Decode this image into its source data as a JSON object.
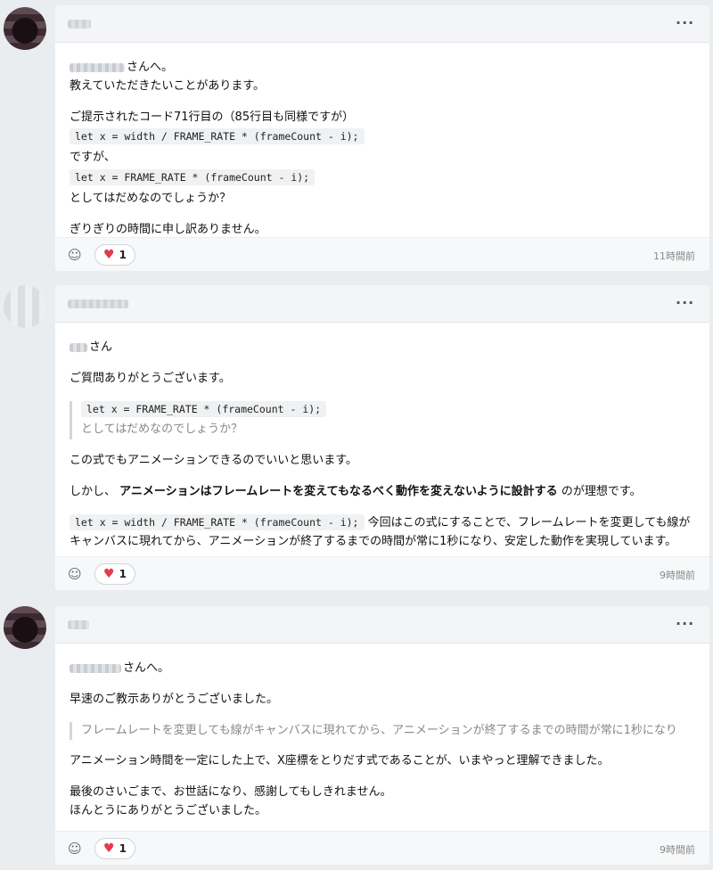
{
  "comments": [
    {
      "username_masked": "",
      "mention_suffix": "さんへ。",
      "lines": {
        "l1": "教えていただきたいことがあります。",
        "l2": "ご提示されたコード71行目の（85行目も同様ですが）",
        "code1": "let x = width / FRAME_RATE * (frameCount - i);",
        "l3": "ですが、",
        "code2": "let x = FRAME_RATE * (frameCount - i);",
        "l4": "としてはだめなのでしょうか？",
        "l5": "ぎりぎりの時間に申し訳ありません。"
      },
      "like_count": "1",
      "timestamp": "11時間前"
    },
    {
      "mention_suffix": "さん",
      "lines": {
        "l1": "ご質問ありがとうございます。",
        "quote_code": "let x = FRAME_RATE * (frameCount - i);",
        "quote_text": "としてはだめなのでしょうか？",
        "l2": "この式でもアニメーションできるのでいいと思います。",
        "l3_prefix": "しかし、",
        "l3_bold": "アニメーションはフレームレートを変えてもなるべく動作を変えないように設計する",
        "l3_suffix": "のが理想です。",
        "code": "let x = width / FRAME_RATE * (frameCount - i);",
        "l4": "今回はこの式にすることで、フレームレートを変更しても線がキャンバスに現れてから、アニメーションが終了するまでの時間が常に1秒になり、安定した動作を実現しています。"
      },
      "like_count": "1",
      "timestamp": "9時間前"
    },
    {
      "mention_suffix": "さんへ。",
      "lines": {
        "l1": "早速のご教示ありがとうございました。",
        "quote": "フレームレートを変更しても線がキャンバスに現れてから、アニメーションが終了するまでの時間が常に1秒になり",
        "l2": "アニメーション時間を一定にした上で、X座標をとりだす式であることが、いまやっと理解できました。",
        "l3": "最後のさいごまで、お世話になり、感謝してもしきれません。",
        "l4": "ほんとうにありがとうございました。"
      },
      "like_count": "1",
      "timestamp": "9時間前"
    }
  ],
  "icons": {
    "more": "more-horizontal-icon",
    "add_reaction": "add-reaction-icon",
    "heart": "heart-icon"
  },
  "colors": {
    "heart": "#e53a4b",
    "page_bg": "#e9edf0"
  }
}
